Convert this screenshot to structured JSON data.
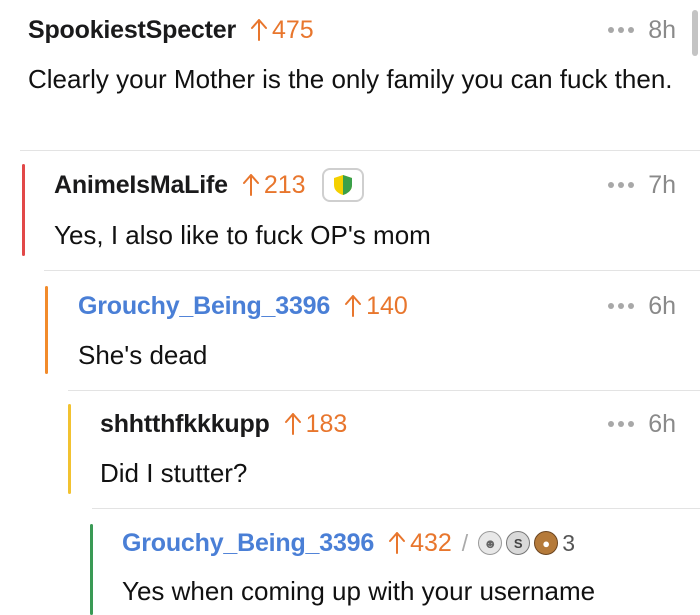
{
  "comments": [
    {
      "username": "SpookiestSpecter",
      "score": "475",
      "time": "8h",
      "body": "Clearly your Mother is the only family you can fuck then."
    },
    {
      "username": "AnimeIsMaLife",
      "score": "213",
      "time": "7h",
      "body": "Yes, I also like to fuck OP's mom",
      "thread_color": "#e24848"
    },
    {
      "username": "Grouchy_Being_3396",
      "score": "140",
      "time": "6h",
      "body": "She's dead",
      "thread_color": "#f28b2b"
    },
    {
      "username": "shhtthfkkkupp",
      "score": "183",
      "time": "6h",
      "body": "Did I stutter?",
      "thread_color": "#f2c230"
    },
    {
      "username": "Grouchy_Being_3396",
      "score": "432",
      "award_count": "3",
      "body": "Yes when coming up with your username",
      "thread_color": "#3a9a55"
    }
  ],
  "colors": {
    "upvote": "#e8762d",
    "op_username": "#4a7fd6"
  },
  "icons": {
    "upvote": "upvote-arrow-icon",
    "more": "more-dots-icon",
    "flair": "shield-badge-icon",
    "awards": [
      "chat-bubble-award-icon",
      "silver-award-icon",
      "bear-award-icon"
    ]
  }
}
